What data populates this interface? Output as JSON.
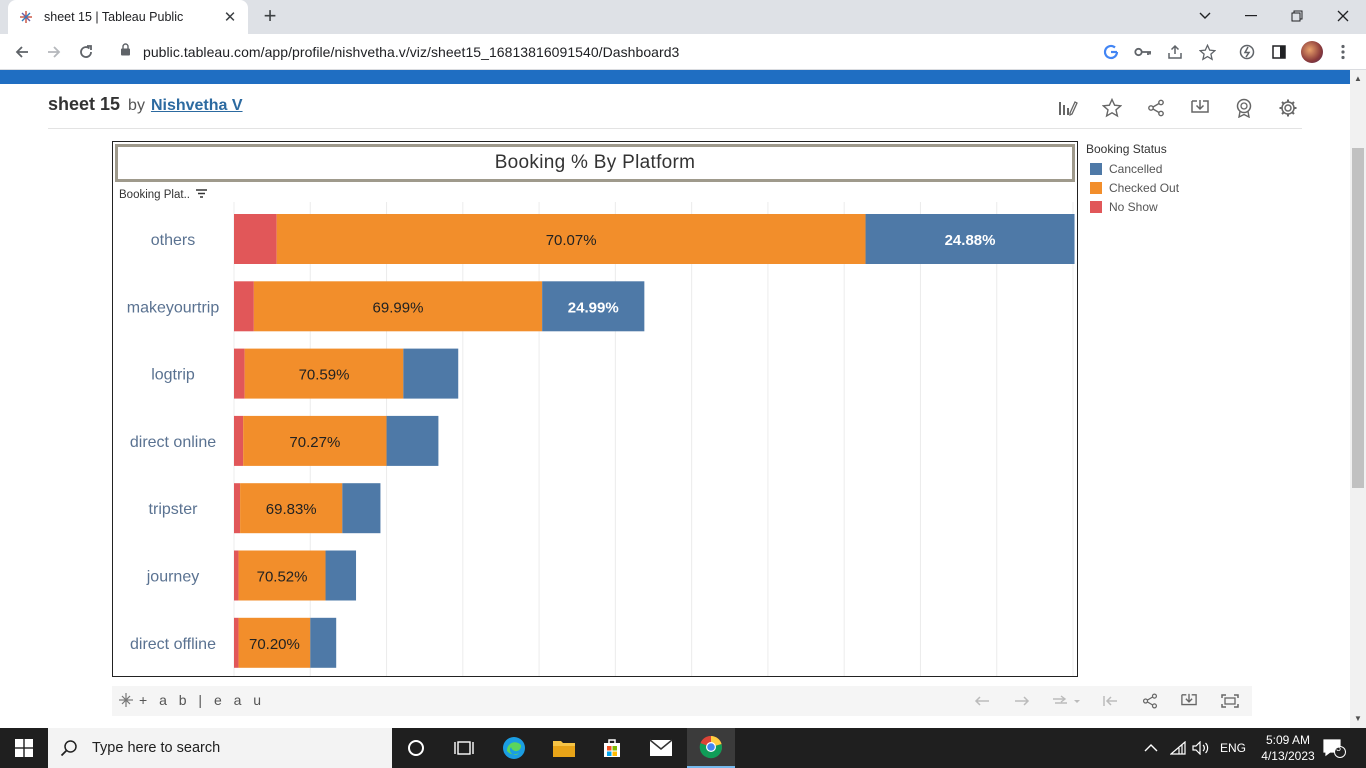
{
  "browser": {
    "tab_title": "sheet 15 | Tableau Public",
    "url": "public.tableau.com/app/profile/nishvetha.v/viz/sheet15_16813816091540/Dashboard3"
  },
  "viz": {
    "title": "sheet 15",
    "by": "by",
    "author": "Nishvetha V"
  },
  "dashboard": {
    "chart_title": "Booking % By Platform",
    "column_header": "Booking Plat..",
    "legend_title": "Booking Status",
    "legend": [
      {
        "label": "Cancelled",
        "color": "#4e79a7"
      },
      {
        "label": "Checked Out",
        "color": "#f28e2b"
      },
      {
        "label": "No Show",
        "color": "#e15759"
      }
    ]
  },
  "chart_data": {
    "type": "bar",
    "orientation": "horizontal",
    "stacked": true,
    "categories": [
      "others",
      "makeyourtrip",
      "logtrip",
      "direct online",
      "tripster",
      "journey",
      "direct offline"
    ],
    "series": [
      {
        "name": "No Show",
        "color": "#e15759",
        "values": [
          2.8,
          1.3,
          0.7,
          0.6,
          0.4,
          0.3,
          0.3
        ]
      },
      {
        "name": "Checked Out",
        "color": "#f28e2b",
        "values": [
          38.6,
          18.9,
          10.4,
          9.4,
          6.7,
          5.7,
          4.7
        ]
      },
      {
        "name": "Cancelled",
        "color": "#4e79a7",
        "values": [
          13.7,
          6.7,
          3.6,
          3.4,
          2.5,
          2.0,
          1.7
        ]
      }
    ],
    "labels": {
      "Checked Out": [
        "70.07%",
        "69.99%",
        "70.59%",
        "70.27%",
        "69.83%",
        "70.52%",
        "70.20%"
      ],
      "Cancelled": [
        "24.88%",
        "24.99%",
        "",
        "",
        "",
        "",
        ""
      ]
    },
    "xlim": [
      0,
      55
    ],
    "grid": true,
    "legend_position": "right"
  },
  "footer": {
    "logo_text": "+ a b | e a u"
  },
  "taskbar": {
    "search_placeholder": "Type here to search",
    "language": "ENG",
    "time": "5:09 AM",
    "date": "4/13/2023",
    "notification_count": "5"
  }
}
